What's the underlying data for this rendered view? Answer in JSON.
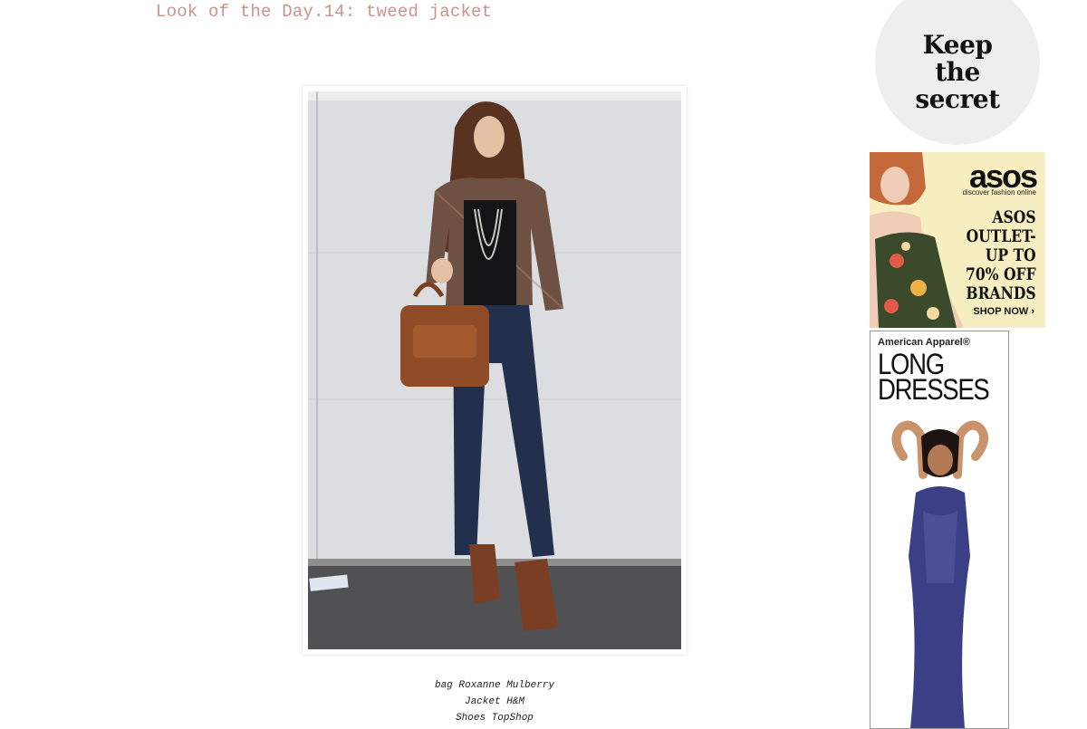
{
  "post": {
    "title": "Look of the Day.14: tweed jacket",
    "credits": [
      "bag Roxanne Mulberry",
      "Jacket H&M",
      "Shoes TopShop"
    ]
  },
  "sidebar": {
    "badge": {
      "lines": [
        "Keep",
        "the",
        "secret"
      ]
    },
    "asos_ad": {
      "logo": "asos",
      "tagline": "discover fashion online",
      "headline_lines": [
        "ASOS",
        "OUTLET-",
        "UP TO",
        "70% OFF",
        "BRANDS"
      ],
      "cta": "SHOP NOW ›"
    },
    "american_apparel_ad": {
      "brand": "American Apparel®",
      "headline_lines": [
        "LONG",
        "DRESSES"
      ]
    }
  },
  "colors": {
    "title": "#c9948e",
    "badge_bg": "#eeeeee",
    "asos_bg": "#f7efc2",
    "dress": "#3a3f86"
  }
}
